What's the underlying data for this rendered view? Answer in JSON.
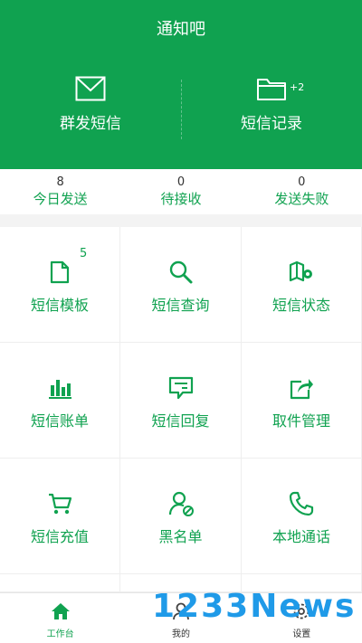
{
  "app_title": "通知吧",
  "hero": {
    "group_send_label": "群发短信",
    "records_label": "短信记录",
    "records_badge": "+2"
  },
  "stats": [
    {
      "value": "8",
      "label": "今日发送"
    },
    {
      "value": "0",
      "label": "待接收"
    },
    {
      "value": "0",
      "label": "发送失败"
    }
  ],
  "grid": [
    {
      "label": "短信模板",
      "icon": "document-icon",
      "count": "5"
    },
    {
      "label": "短信查询",
      "icon": "search-icon"
    },
    {
      "label": "短信状态",
      "icon": "map-pin-icon"
    },
    {
      "label": "短信账单",
      "icon": "bar-chart-icon"
    },
    {
      "label": "短信回复",
      "icon": "message-reply-icon"
    },
    {
      "label": "取件管理",
      "icon": "share-icon"
    },
    {
      "label": "短信充值",
      "icon": "cart-icon"
    },
    {
      "label": "黑名单",
      "icon": "user-block-icon"
    },
    {
      "label": "本地通话",
      "icon": "phone-icon"
    }
  ],
  "tabs": [
    {
      "label": "工作台",
      "icon": "home-icon",
      "active": true
    },
    {
      "label": "我的",
      "icon": "user-icon"
    },
    {
      "label": "设置",
      "icon": "gear-icon"
    }
  ],
  "watermark": "1233News",
  "colors": {
    "brand": "#10a250",
    "watermark": "#1f9ae8"
  }
}
